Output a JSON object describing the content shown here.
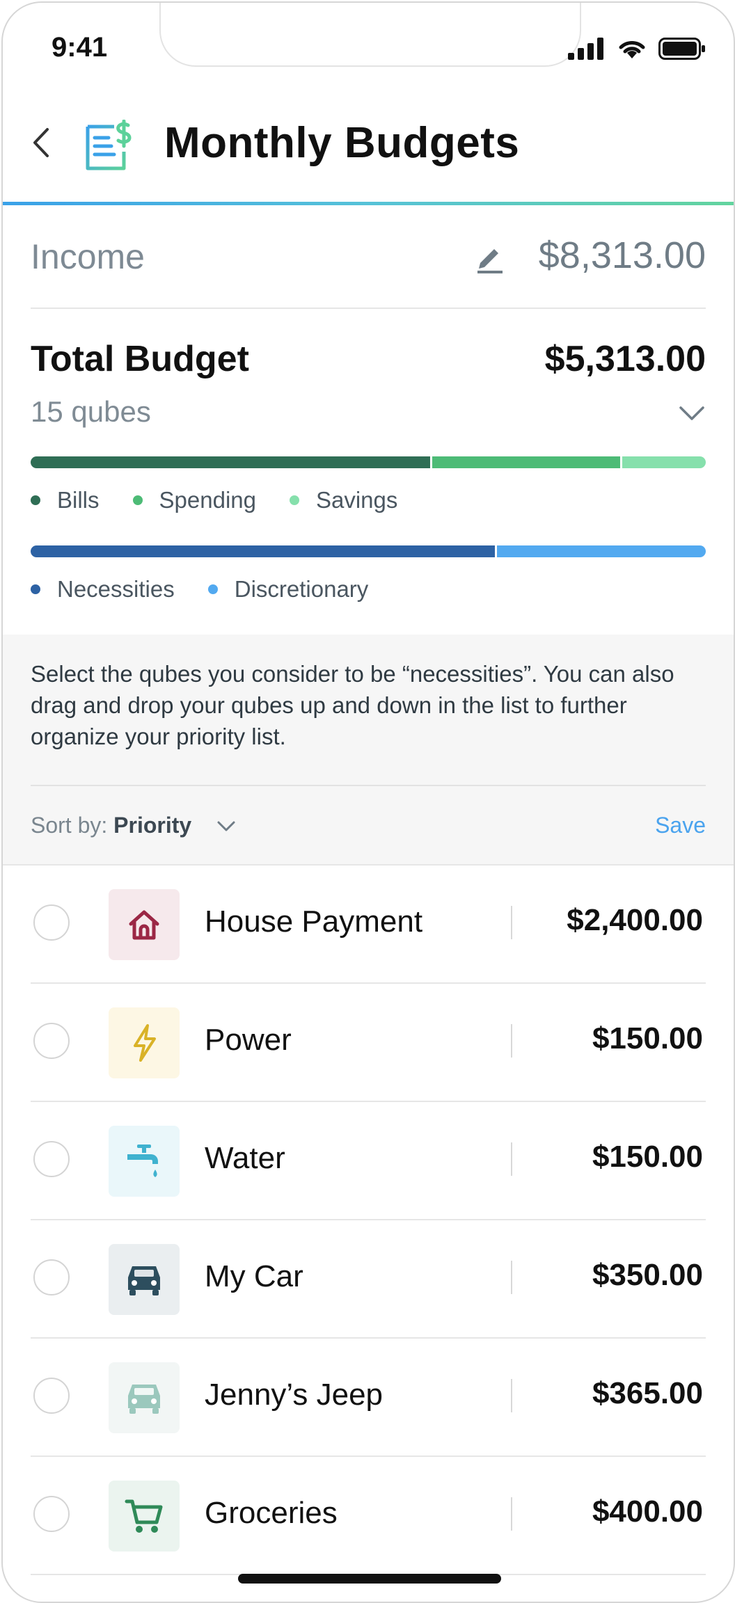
{
  "status_bar": {
    "time": "9:41"
  },
  "header": {
    "title": "Monthly Budgets"
  },
  "income": {
    "label": "Income",
    "value": "$8,313.00"
  },
  "total_budget": {
    "label": "Total Budget",
    "value": "$5,313.00",
    "qubes_count": "15 qubes"
  },
  "category_bar": {
    "segments": [
      {
        "name": "Bills",
        "fraction": 0.595,
        "color": "#2f6e55"
      },
      {
        "name": "Spending",
        "fraction": 0.28,
        "color": "#4dbb76"
      },
      {
        "name": "Savings",
        "fraction": 0.125,
        "color": "#86e0ac"
      }
    ]
  },
  "priority_bar": {
    "segments": [
      {
        "name": "Necessities",
        "fraction": 0.69,
        "color": "#2d62a4"
      },
      {
        "name": "Discretionary",
        "fraction": 0.31,
        "color": "#52a9f0"
      }
    ]
  },
  "help": {
    "text": "Select the qubes you consider to be “necessities”. You can also drag and drop your qubes up and down in the list to further organize your priority list."
  },
  "sort": {
    "prefix": "Sort by:",
    "value": "Priority",
    "save_label": "Save"
  },
  "qubes": [
    {
      "name": "House Payment",
      "amount": "$2,400.00",
      "icon": "house-icon",
      "bg": "#f6e9ec",
      "fg": "#9b2745"
    },
    {
      "name": "Power",
      "amount": "$150.00",
      "icon": "lightning-icon",
      "bg": "#fdf7e4",
      "fg": "#d9b227"
    },
    {
      "name": "Water",
      "amount": "$150.00",
      "icon": "faucet-icon",
      "bg": "#eaf7fa",
      "fg": "#3fb2cf"
    },
    {
      "name": "My Car",
      "amount": "$350.00",
      "icon": "car-icon",
      "bg": "#eaeef0",
      "fg": "#2d4e5e"
    },
    {
      "name": "Jenny’s Jeep",
      "amount": "$365.00",
      "icon": "car-icon",
      "bg": "#f2f6f5",
      "fg": "#9bc8bd"
    },
    {
      "name": "Groceries",
      "amount": "$400.00",
      "icon": "cart-icon",
      "bg": "#ebf4ef",
      "fg": "#2f8a58"
    }
  ]
}
